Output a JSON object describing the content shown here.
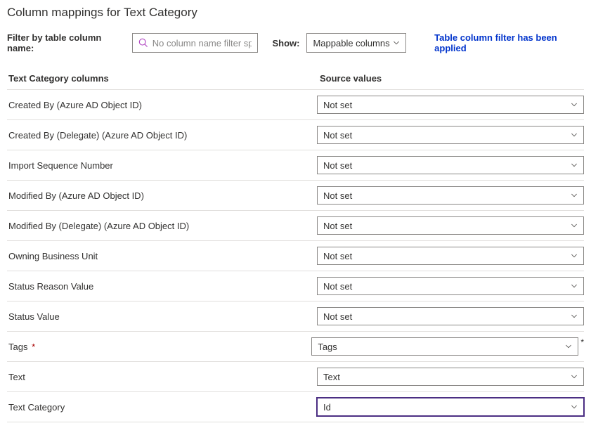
{
  "page_title": "Column mappings for Text Category",
  "filter": {
    "label": "Filter by table column name:",
    "placeholder": "No column name filter sp..."
  },
  "show": {
    "label": "Show:",
    "value": "Mappable columns"
  },
  "filter_applied_msg": "Table column filter has been applied",
  "headers": {
    "left": "Text Category columns",
    "right": "Source values"
  },
  "required_mark": "*",
  "rows": [
    {
      "label": "Created By (Azure AD Object ID)",
      "value": "Not set",
      "required": false,
      "highlighted": false
    },
    {
      "label": "Created By (Delegate) (Azure AD Object ID)",
      "value": "Not set",
      "required": false,
      "highlighted": false
    },
    {
      "label": "Import Sequence Number",
      "value": "Not set",
      "required": false,
      "highlighted": false
    },
    {
      "label": "Modified By (Azure AD Object ID)",
      "value": "Not set",
      "required": false,
      "highlighted": false
    },
    {
      "label": "Modified By (Delegate) (Azure AD Object ID)",
      "value": "Not set",
      "required": false,
      "highlighted": false
    },
    {
      "label": "Owning Business Unit",
      "value": "Not set",
      "required": false,
      "highlighted": false
    },
    {
      "label": "Status Reason Value",
      "value": "Not set",
      "required": false,
      "highlighted": false
    },
    {
      "label": "Status Value",
      "value": "Not set",
      "required": false,
      "highlighted": false
    },
    {
      "label": "Tags",
      "value": "Tags",
      "required": true,
      "highlighted": false
    },
    {
      "label": "Text",
      "value": "Text",
      "required": false,
      "highlighted": false
    },
    {
      "label": "Text Category",
      "value": "Id",
      "required": false,
      "highlighted": true
    }
  ]
}
